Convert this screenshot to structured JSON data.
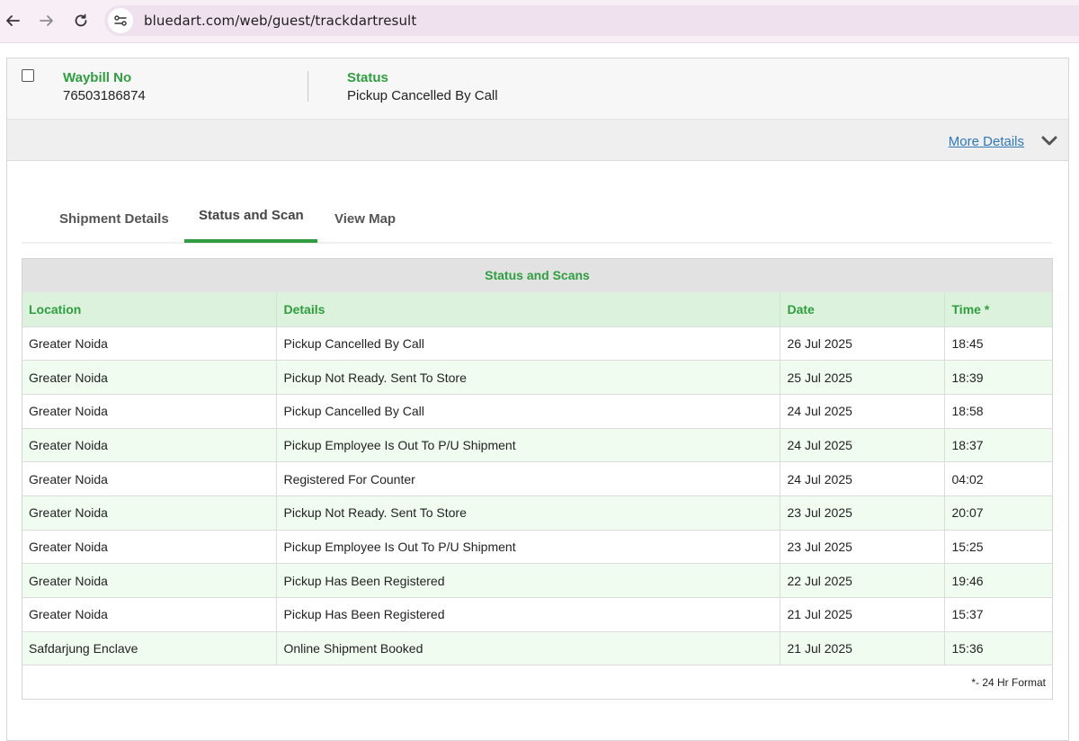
{
  "browser": {
    "url": "bluedart.com/web/guest/trackdartresult"
  },
  "summary": {
    "waybill_label": "Waybill No",
    "waybill_value": "76503186874",
    "status_label": "Status",
    "status_value": "Pickup Cancelled By Call",
    "more_details": "More Details"
  },
  "tabs": [
    {
      "label": "Shipment Details",
      "active": false
    },
    {
      "label": "Status and Scan",
      "active": true
    },
    {
      "label": "View Map",
      "active": false
    }
  ],
  "scan_table": {
    "caption": "Status and Scans",
    "headers": [
      "Location",
      "Details",
      "Date",
      "Time *"
    ],
    "rows": [
      [
        "Greater Noida",
        "Pickup Cancelled By Call",
        "26 Jul 2025",
        "18:45"
      ],
      [
        "Greater Noida",
        "Pickup Not Ready. Sent To Store",
        "25 Jul 2025",
        "18:39"
      ],
      [
        "Greater Noida",
        "Pickup Cancelled By Call",
        "24 Jul 2025",
        "18:58"
      ],
      [
        "Greater Noida",
        "Pickup Employee Is Out To P/U Shipment",
        "24 Jul 2025",
        "18:37"
      ],
      [
        "Greater Noida",
        "Registered For Counter",
        "24 Jul 2025",
        "04:02"
      ],
      [
        "Greater Noida",
        "Pickup Not Ready. Sent To Store",
        "23 Jul 2025",
        "20:07"
      ],
      [
        "Greater Noida",
        "Pickup Employee Is Out To P/U Shipment",
        "23 Jul 2025",
        "15:25"
      ],
      [
        "Greater Noida",
        "Pickup Has Been Registered",
        "22 Jul 2025",
        "19:46"
      ],
      [
        "Greater Noida",
        "Pickup Has Been Registered",
        "21 Jul 2025",
        "15:37"
      ],
      [
        "Safdarjung Enclave",
        "Online Shipment Booked",
        "21 Jul 2025",
        "15:36"
      ]
    ],
    "footnote": "*- 24 Hr Format"
  },
  "colors": {
    "accent_green": "#2e9e3f",
    "link_blue": "#2f78b8",
    "row_alt": "#f1fcf1",
    "header_bg": "#dcf2dc"
  }
}
